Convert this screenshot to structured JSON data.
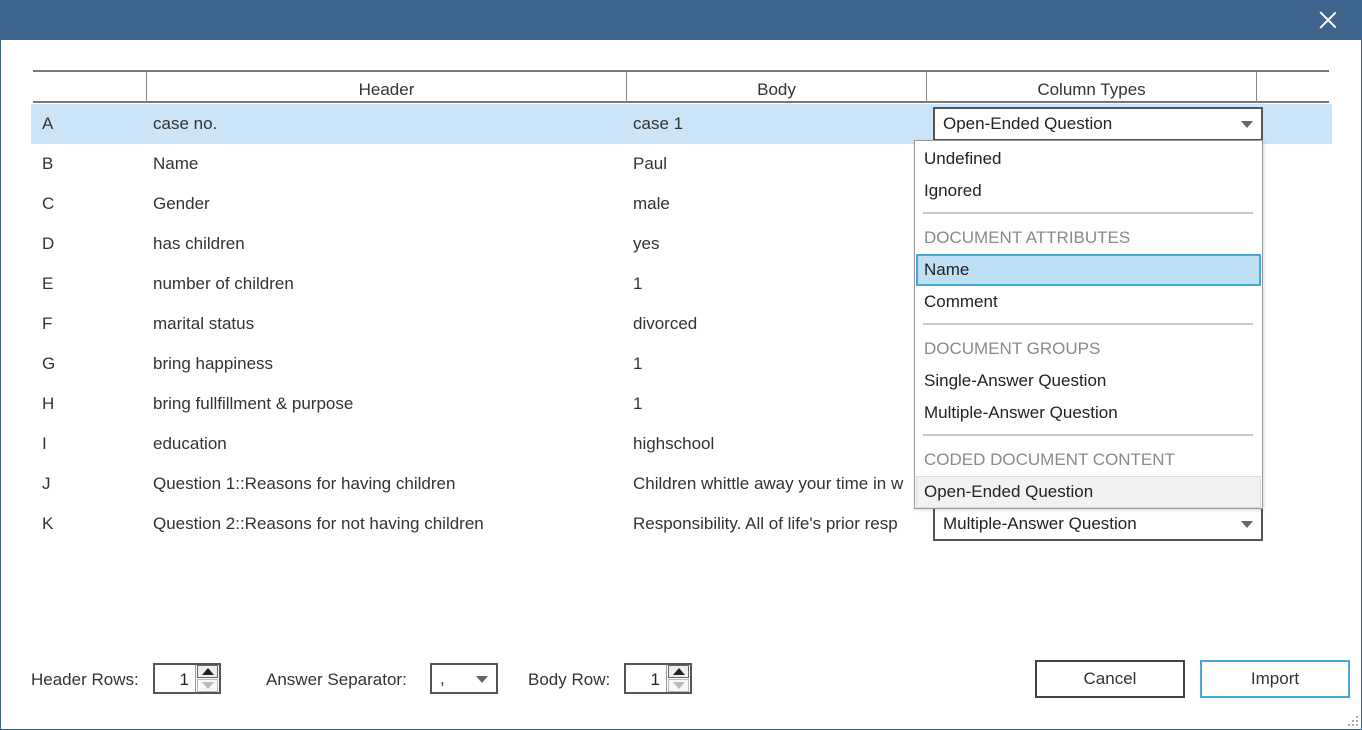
{
  "window": {
    "close_icon": "close-icon"
  },
  "table": {
    "columns": {
      "index": "",
      "header": "Header",
      "body": "Body",
      "types": "Column Types"
    },
    "rows": [
      {
        "letter": "A",
        "header": "case no.",
        "body": "case 1",
        "type": "Open-Ended Question"
      },
      {
        "letter": "B",
        "header": "Name",
        "body": "Paul",
        "type": ""
      },
      {
        "letter": "C",
        "header": "Gender",
        "body": "male",
        "type": ""
      },
      {
        "letter": "D",
        "header": "has children",
        "body": "yes",
        "type": ""
      },
      {
        "letter": "E",
        "header": "number of children",
        "body": "1",
        "type": ""
      },
      {
        "letter": "F",
        "header": "marital status",
        "body": "divorced",
        "type": ""
      },
      {
        "letter": "G",
        "header": "bring happiness",
        "body": "1",
        "type": ""
      },
      {
        "letter": "H",
        "header": "bring fullfillment & purpose",
        "body": "1",
        "type": ""
      },
      {
        "letter": "I",
        "header": "education",
        "body": "highschool",
        "type": ""
      },
      {
        "letter": "J",
        "header": "Question 1::Reasons for having children",
        "body": "Children whittle away your time in w",
        "type": ""
      },
      {
        "letter": "K",
        "header": "Question 2::Reasons for not having children",
        "body": "Responsibility. All of life's prior resp",
        "type": "Multiple-Answer Question"
      }
    ]
  },
  "dropdown": {
    "item_undefined": "Undefined",
    "item_ignored": "Ignored",
    "group_attributes": "DOCUMENT ATTRIBUTES",
    "item_name": "Name",
    "item_comment": "Comment",
    "group_groups": "DOCUMENT GROUPS",
    "item_single": "Single-Answer Question",
    "item_multiple": "Multiple-Answer Question",
    "group_coded": "CODED DOCUMENT CONTENT",
    "item_open": "Open-Ended Question"
  },
  "footer": {
    "header_rows_label": "Header Rows:",
    "header_rows_value": "1",
    "answer_separator_label": "Answer Separator:",
    "answer_separator_value": ",",
    "body_row_label": "Body Row:",
    "body_row_value": "1",
    "cancel_label": "Cancel",
    "import_label": "Import"
  }
}
